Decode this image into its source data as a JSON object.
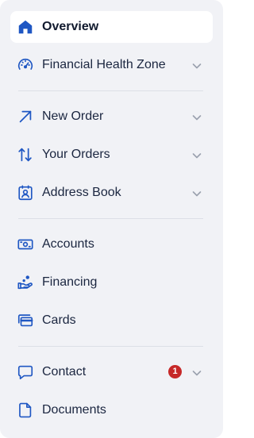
{
  "colors": {
    "panel_bg": "#f1f2f6",
    "active_bg": "#ffffff",
    "icon_blue": "#1f57c3",
    "chevron_gray": "#9aa1ae",
    "badge_red": "#c62828"
  },
  "nav": {
    "items": [
      {
        "label": "Overview",
        "icon": "home-icon",
        "active": true
      },
      {
        "label": "Financial Health Zone",
        "icon": "gauge-icon",
        "expandable": true
      },
      {
        "label": "New Order",
        "icon": "arrow-up-right-icon",
        "expandable": true
      },
      {
        "label": "Your Orders",
        "icon": "swap-vertical-icon",
        "expandable": true
      },
      {
        "label": "Address Book",
        "icon": "address-book-icon",
        "expandable": true
      },
      {
        "label": "Accounts",
        "icon": "banknote-icon"
      },
      {
        "label": "Financing",
        "icon": "hand-coin-icon"
      },
      {
        "label": "Cards",
        "icon": "cards-icon"
      },
      {
        "label": "Contact",
        "icon": "chat-bubble-icon",
        "expandable": true,
        "badge": "1"
      },
      {
        "label": "Documents",
        "icon": "document-icon"
      }
    ]
  }
}
